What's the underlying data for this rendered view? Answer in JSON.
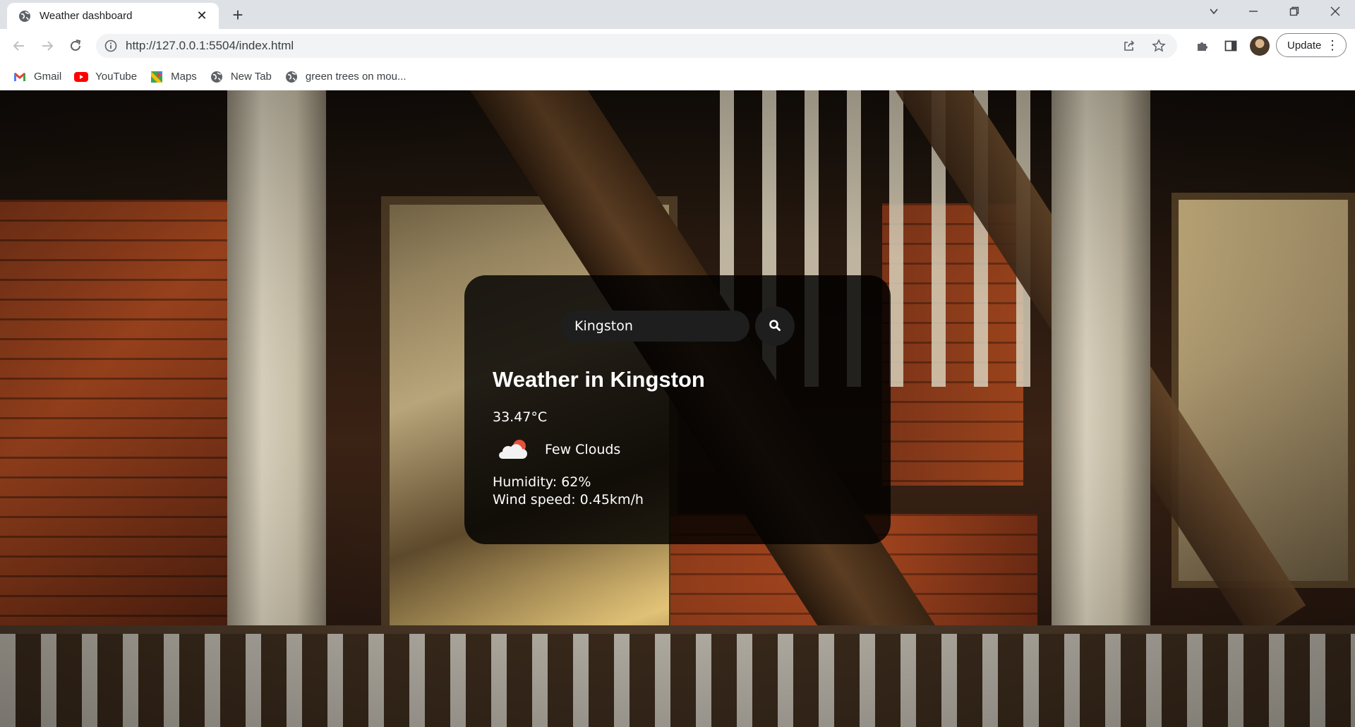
{
  "browser": {
    "tab": {
      "title": "Weather dashboard",
      "close_symbol": "✕"
    },
    "new_tab_symbol": "+",
    "window_controls": {
      "tab_search": "⌄",
      "minimize": "—",
      "restore": "❐",
      "close": "✕"
    },
    "address": {
      "url": "http://127.0.0.1:5504/index.html"
    },
    "update_button": {
      "label": "Update",
      "menu_symbol": "⋮"
    },
    "bookmarks": [
      {
        "label": "Gmail",
        "icon": "gmail-icon"
      },
      {
        "label": "YouTube",
        "icon": "youtube-icon"
      },
      {
        "label": "Maps",
        "icon": "maps-icon"
      },
      {
        "label": "New Tab",
        "icon": "globe-icon"
      },
      {
        "label": "green trees on mou...",
        "icon": "globe-icon"
      }
    ]
  },
  "weather": {
    "search": {
      "value": "Kingston",
      "placeholder": "Search"
    },
    "title": "Weather in Kingston",
    "temperature": "33.47°C",
    "icon": "few-clouds-icon",
    "description": "Few Clouds",
    "humidity": "Humidity: 62%",
    "wind": "Wind speed: 0.45km/h"
  },
  "colors": {
    "card_bg": "#000000d1",
    "text": "#ffffff",
    "chrome_tabbar": "#dee1e6",
    "omnibox": "#f1f3f4"
  }
}
